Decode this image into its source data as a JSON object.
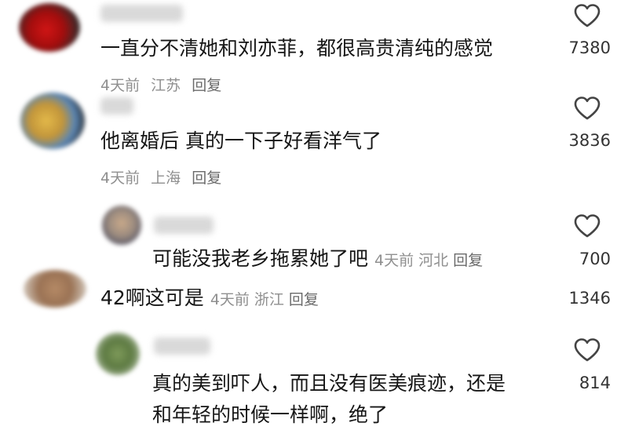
{
  "comments": [
    {
      "text": "一直分不清她和刘亦菲，都很高贵清纯的感觉",
      "time": "4天前",
      "location": "江苏",
      "reply_label": "回复",
      "likes": "7380"
    },
    {
      "text": "他离婚后 真的一下子好看洋气了",
      "time": "4天前",
      "location": "上海",
      "reply_label": "回复",
      "likes": "3836"
    },
    {
      "text": "可能没我老乡拖累她了吧",
      "time": "4天前",
      "location": "河北",
      "reply_label": "回复",
      "likes": "700"
    },
    {
      "text": "42啊这可是",
      "time": "4天前",
      "location": "浙江",
      "reply_label": "回复",
      "likes": "1346"
    },
    {
      "text_line1": "真的美到吓人，而且没有医美痕迹，还是",
      "text_line2": "和年轻的时候一样啊，绝了",
      "likes": "814"
    }
  ],
  "colors": {
    "text": "#161616",
    "meta": "#8f8f8f",
    "heart_stroke": "#444444"
  },
  "icons": [
    "heart-outline-icon"
  ]
}
